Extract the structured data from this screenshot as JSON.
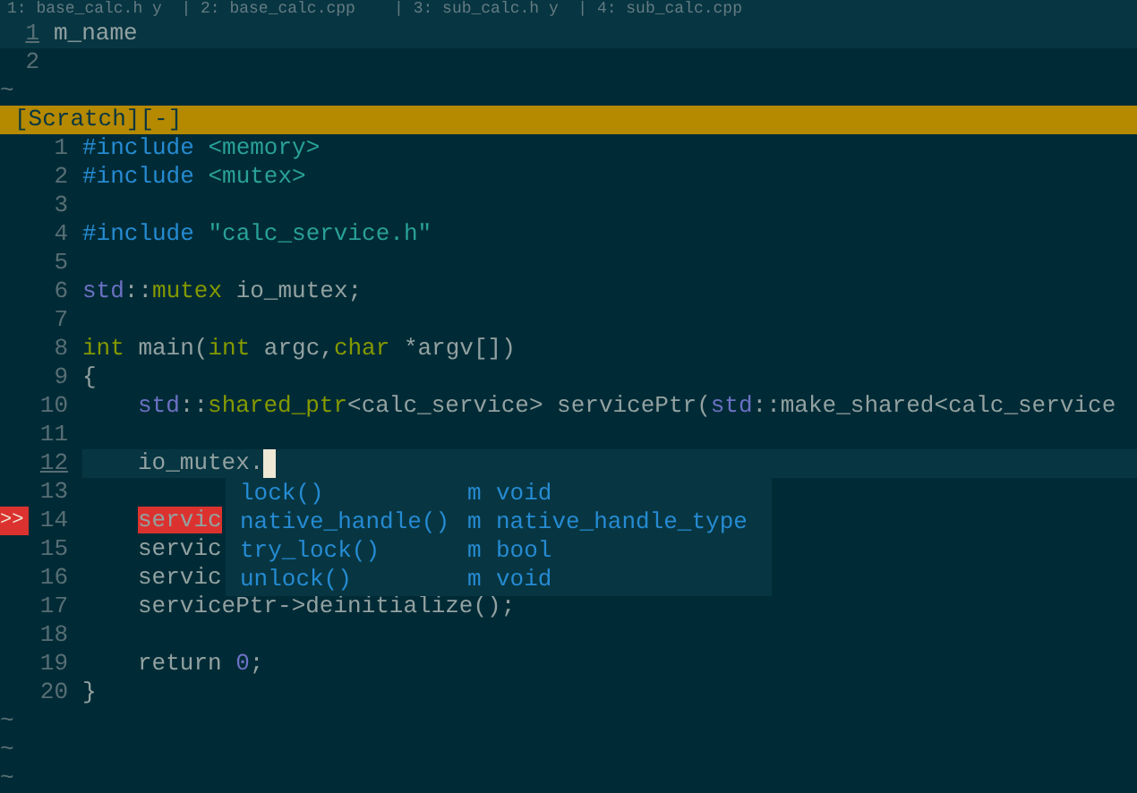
{
  "tabline": "1: base_calc.h y  | 2: base_calc.cpp    | 3: sub_calc.h y  | 4: sub_calc.cpp",
  "scratch": {
    "lines": [
      {
        "number": "1",
        "text": "m_name",
        "current": true
      },
      {
        "number": "2",
        "current": false
      }
    ],
    "tildes": [
      "~"
    ]
  },
  "status_bar": "[Scratch][-]",
  "editor": {
    "lines": [
      {
        "number": "1",
        "current": false,
        "indent": false,
        "tokens": [
          {
            "text": "#include",
            "kind": "preproc"
          },
          {
            "text": " <memory>",
            "kind": "string"
          }
        ]
      },
      {
        "number": "2",
        "current": false,
        "indent": false,
        "tokens": [
          {
            "text": "#include",
            "kind": "preproc"
          },
          {
            "text": " <mutex>",
            "kind": "string"
          }
        ]
      },
      {
        "number": "3",
        "current": false,
        "indent": false
      },
      {
        "number": "4",
        "current": false,
        "indent": false,
        "tokens": [
          {
            "text": "#include",
            "kind": "preproc"
          },
          {
            "text": " \"calc_service.h\"",
            "kind": "string"
          }
        ]
      },
      {
        "number": "5",
        "current": false,
        "indent": false
      },
      {
        "number": "6",
        "current": false,
        "indent": false,
        "tokens": [
          {
            "text": "std",
            "kind": "namespace"
          },
          {
            "text": "::",
            "kind": "plain"
          },
          {
            "text": "mutex",
            "kind": "type"
          },
          {
            "text": " io_mutex;",
            "kind": "plain"
          }
        ]
      },
      {
        "number": "7",
        "current": false,
        "indent": false
      },
      {
        "number": "8",
        "current": false,
        "indent": false,
        "tokens": [
          {
            "text": "int",
            "kind": "type"
          },
          {
            "text": " main(",
            "kind": "plain"
          },
          {
            "text": "int",
            "kind": "type"
          },
          {
            "text": " argc,",
            "kind": "plain"
          },
          {
            "text": "char",
            "kind": "type"
          },
          {
            "text": " *argv[])",
            "kind": "plain"
          }
        ]
      },
      {
        "number": "9",
        "current": false,
        "indent": false,
        "tokens": [
          {
            "text": "{",
            "kind": "plain"
          }
        ]
      },
      {
        "number": "10",
        "current": false,
        "indent": true,
        "tokens": [
          {
            "text": "std",
            "kind": "namespace"
          },
          {
            "text": "::",
            "kind": "plain"
          },
          {
            "text": "shared_ptr",
            "kind": "type"
          },
          {
            "text": "<calc_service> servicePtr(",
            "kind": "plain"
          },
          {
            "text": "std",
            "kind": "namespace"
          },
          {
            "text": "::make_shared<calc_service",
            "kind": "plain"
          }
        ]
      },
      {
        "number": "11",
        "current": false,
        "indent": false
      },
      {
        "number": "12",
        "current": true,
        "cursor": true,
        "indent": true,
        "tokens": [
          {
            "text": "io_mutex.",
            "kind": "plain"
          }
        ]
      },
      {
        "number": "13",
        "current": false,
        "indent": false
      },
      {
        "number": "14",
        "current": false,
        "indent": true,
        "sign": ">>",
        "tokens": [
          {
            "text": "servic",
            "kind": "error"
          }
        ]
      },
      {
        "number": "15",
        "current": false,
        "indent": true,
        "tokens": [
          {
            "text": "servic",
            "kind": "plain"
          }
        ]
      },
      {
        "number": "16",
        "current": false,
        "indent": true,
        "tokens": [
          {
            "text": "servic",
            "kind": "plain"
          }
        ]
      },
      {
        "number": "17",
        "current": false,
        "indent": true,
        "tokens": [
          {
            "text": "servicePtr->deinitialize();",
            "kind": "plain"
          }
        ]
      },
      {
        "number": "18",
        "current": false,
        "indent": false
      },
      {
        "number": "19",
        "current": false,
        "indent": true,
        "tokens": [
          {
            "text": "return ",
            "kind": "plain"
          },
          {
            "text": "0",
            "kind": "number"
          },
          {
            "text": ";",
            "kind": "plain"
          }
        ]
      },
      {
        "number": "20",
        "current": false,
        "indent": false,
        "tokens": [
          {
            "text": "}",
            "kind": "plain"
          }
        ]
      }
    ],
    "tildes": [
      "~",
      "~",
      "~"
    ]
  },
  "completion_menu": {
    "items": [
      {
        "name": "lock()",
        "kind": "m",
        "type": "void"
      },
      {
        "name": "native_handle()",
        "kind": "m",
        "type": "native_handle_type"
      },
      {
        "name": "try_lock()",
        "kind": "m",
        "type": "bool"
      },
      {
        "name": "unlock()",
        "kind": "m",
        "type": "void"
      }
    ]
  }
}
